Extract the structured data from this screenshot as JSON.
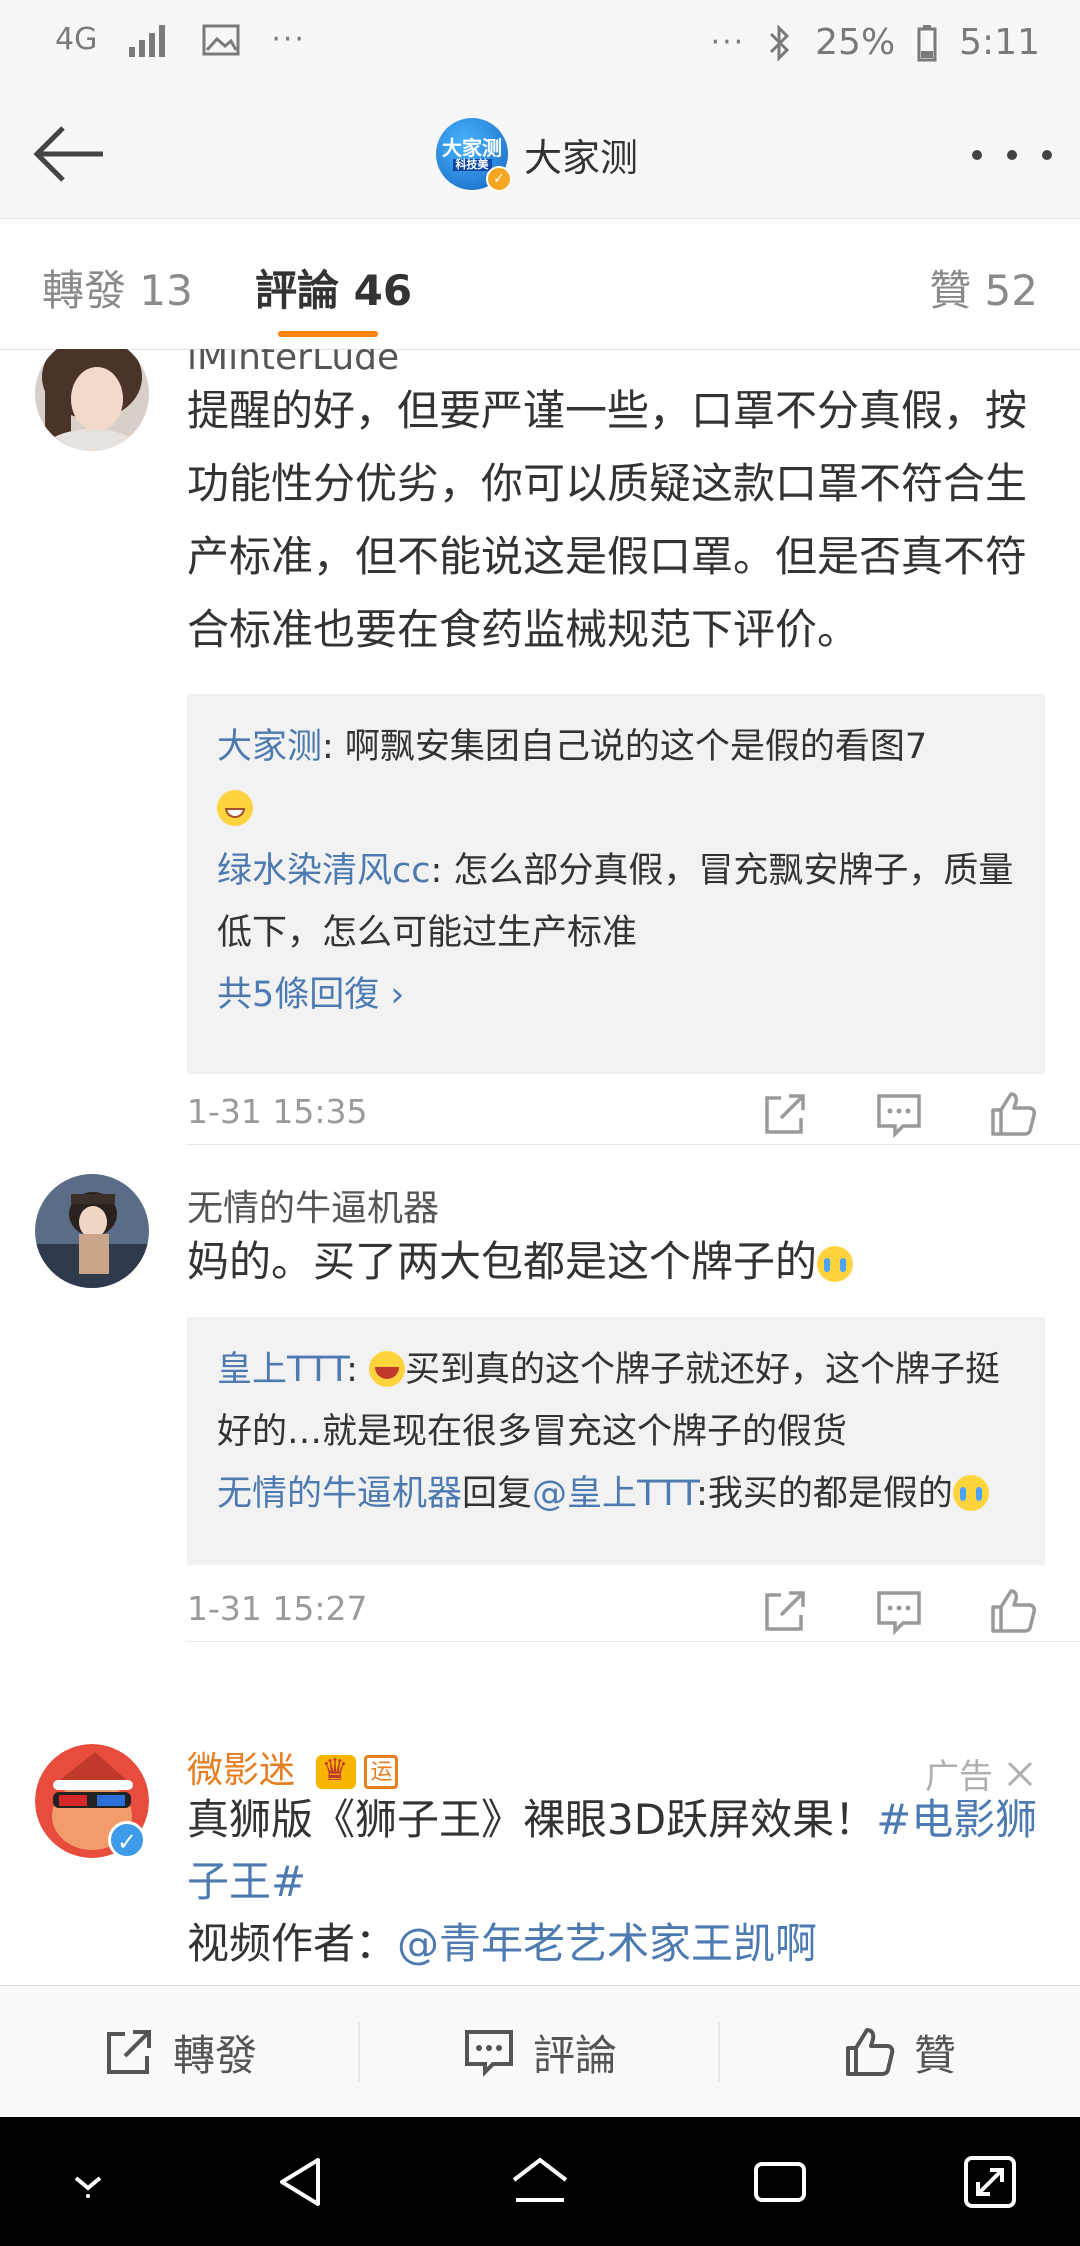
{
  "status_bar": {
    "network": "4G",
    "battery": "25%",
    "time": "5:11"
  },
  "header": {
    "title": "大家测",
    "logo_text": "大家测",
    "logo_subtext": "科技美"
  },
  "tabs": [
    {
      "label": "轉發 13"
    },
    {
      "label": "評論 46"
    },
    {
      "label": "贊 52"
    }
  ],
  "comments": [
    {
      "username": "iMinterLude",
      "content": "提醒的好，但要严谨一些，口罩不分真假，按功能性分优劣，你可以质疑这款口罩不符合生产标准，但不能说这是假口罩。但是否真不符合标准也要在食药监械规范下评价。",
      "replies": [
        {
          "user": "大家测",
          "text": ": 啊飘安集团自己说的这个是假的看图7",
          "emoji": "grin"
        },
        {
          "user": "绿水染清风cc",
          "text": ": 怎么部分真假，冒充飘安牌子，质量低下，怎么可能过生产标准"
        }
      ],
      "more_replies": "共5條回復 ›",
      "time": "1-31 15:35"
    },
    {
      "username": "无情的牛逼机器",
      "content": "妈的。买了两大包都是这个牌子的",
      "content_emoji": "cry",
      "replies": [
        {
          "user": "皇上TTT",
          "text_before": ": ",
          "emoji": "laugh",
          "text": "买到真的这个牌子就还好，这个牌子挺好的…就是现在很多冒充这个牌子的假货"
        },
        {
          "user": "无情的牛逼机器",
          "mid": "回复",
          "mention": "@皇上TTT",
          "text": ":我买的都是假的",
          "emoji": "cry"
        }
      ],
      "time": "1-31 15:27"
    },
    {
      "username": "微影迷",
      "is_ad": true,
      "ad_label": "广告",
      "content_pre": "真狮版《狮子王》裸眼3D跃屏效果！",
      "hashtag": "#电影狮子王#",
      "line2_label": "视频作者：",
      "line2_mention": "@青年老艺术家王凯啊"
    }
  ],
  "bottom_bar": {
    "repost": "轉發",
    "comment": "評論",
    "like": "贊"
  },
  "colors": {
    "accent": "#ff8200",
    "link": "#4d7ab1"
  }
}
